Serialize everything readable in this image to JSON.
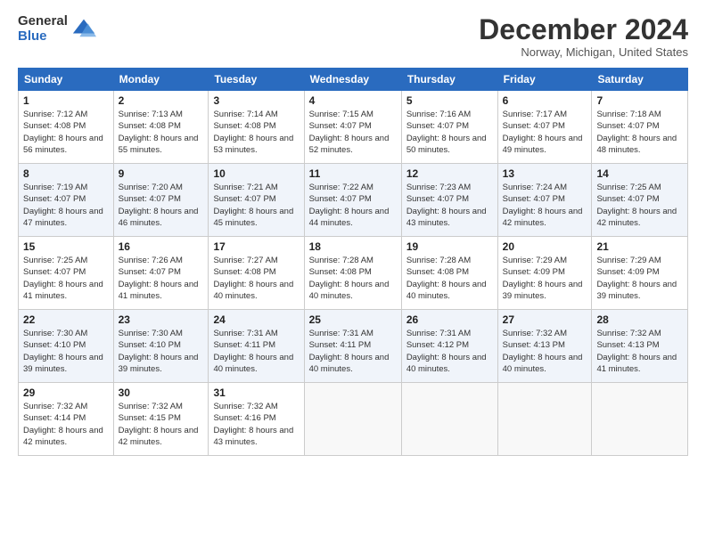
{
  "logo": {
    "general": "General",
    "blue": "Blue"
  },
  "title": "December 2024",
  "subtitle": "Norway, Michigan, United States",
  "days_of_week": [
    "Sunday",
    "Monday",
    "Tuesday",
    "Wednesday",
    "Thursday",
    "Friday",
    "Saturday"
  ],
  "weeks": [
    [
      {
        "day": "1",
        "sunrise": "7:12 AM",
        "sunset": "4:08 PM",
        "daylight": "8 hours and 56 minutes."
      },
      {
        "day": "2",
        "sunrise": "7:13 AM",
        "sunset": "4:08 PM",
        "daylight": "8 hours and 55 minutes."
      },
      {
        "day": "3",
        "sunrise": "7:14 AM",
        "sunset": "4:08 PM",
        "daylight": "8 hours and 53 minutes."
      },
      {
        "day": "4",
        "sunrise": "7:15 AM",
        "sunset": "4:07 PM",
        "daylight": "8 hours and 52 minutes."
      },
      {
        "day": "5",
        "sunrise": "7:16 AM",
        "sunset": "4:07 PM",
        "daylight": "8 hours and 50 minutes."
      },
      {
        "day": "6",
        "sunrise": "7:17 AM",
        "sunset": "4:07 PM",
        "daylight": "8 hours and 49 minutes."
      },
      {
        "day": "7",
        "sunrise": "7:18 AM",
        "sunset": "4:07 PM",
        "daylight": "8 hours and 48 minutes."
      }
    ],
    [
      {
        "day": "8",
        "sunrise": "7:19 AM",
        "sunset": "4:07 PM",
        "daylight": "8 hours and 47 minutes."
      },
      {
        "day": "9",
        "sunrise": "7:20 AM",
        "sunset": "4:07 PM",
        "daylight": "8 hours and 46 minutes."
      },
      {
        "day": "10",
        "sunrise": "7:21 AM",
        "sunset": "4:07 PM",
        "daylight": "8 hours and 45 minutes."
      },
      {
        "day": "11",
        "sunrise": "7:22 AM",
        "sunset": "4:07 PM",
        "daylight": "8 hours and 44 minutes."
      },
      {
        "day": "12",
        "sunrise": "7:23 AM",
        "sunset": "4:07 PM",
        "daylight": "8 hours and 43 minutes."
      },
      {
        "day": "13",
        "sunrise": "7:24 AM",
        "sunset": "4:07 PM",
        "daylight": "8 hours and 42 minutes."
      },
      {
        "day": "14",
        "sunrise": "7:25 AM",
        "sunset": "4:07 PM",
        "daylight": "8 hours and 42 minutes."
      }
    ],
    [
      {
        "day": "15",
        "sunrise": "7:25 AM",
        "sunset": "4:07 PM",
        "daylight": "8 hours and 41 minutes."
      },
      {
        "day": "16",
        "sunrise": "7:26 AM",
        "sunset": "4:07 PM",
        "daylight": "8 hours and 41 minutes."
      },
      {
        "day": "17",
        "sunrise": "7:27 AM",
        "sunset": "4:08 PM",
        "daylight": "8 hours and 40 minutes."
      },
      {
        "day": "18",
        "sunrise": "7:28 AM",
        "sunset": "4:08 PM",
        "daylight": "8 hours and 40 minutes."
      },
      {
        "day": "19",
        "sunrise": "7:28 AM",
        "sunset": "4:08 PM",
        "daylight": "8 hours and 40 minutes."
      },
      {
        "day": "20",
        "sunrise": "7:29 AM",
        "sunset": "4:09 PM",
        "daylight": "8 hours and 39 minutes."
      },
      {
        "day": "21",
        "sunrise": "7:29 AM",
        "sunset": "4:09 PM",
        "daylight": "8 hours and 39 minutes."
      }
    ],
    [
      {
        "day": "22",
        "sunrise": "7:30 AM",
        "sunset": "4:10 PM",
        "daylight": "8 hours and 39 minutes."
      },
      {
        "day": "23",
        "sunrise": "7:30 AM",
        "sunset": "4:10 PM",
        "daylight": "8 hours and 39 minutes."
      },
      {
        "day": "24",
        "sunrise": "7:31 AM",
        "sunset": "4:11 PM",
        "daylight": "8 hours and 40 minutes."
      },
      {
        "day": "25",
        "sunrise": "7:31 AM",
        "sunset": "4:11 PM",
        "daylight": "8 hours and 40 minutes."
      },
      {
        "day": "26",
        "sunrise": "7:31 AM",
        "sunset": "4:12 PM",
        "daylight": "8 hours and 40 minutes."
      },
      {
        "day": "27",
        "sunrise": "7:32 AM",
        "sunset": "4:13 PM",
        "daylight": "8 hours and 40 minutes."
      },
      {
        "day": "28",
        "sunrise": "7:32 AM",
        "sunset": "4:13 PM",
        "daylight": "8 hours and 41 minutes."
      }
    ],
    [
      {
        "day": "29",
        "sunrise": "7:32 AM",
        "sunset": "4:14 PM",
        "daylight": "8 hours and 42 minutes."
      },
      {
        "day": "30",
        "sunrise": "7:32 AM",
        "sunset": "4:15 PM",
        "daylight": "8 hours and 42 minutes."
      },
      {
        "day": "31",
        "sunrise": "7:32 AM",
        "sunset": "4:16 PM",
        "daylight": "8 hours and 43 minutes."
      },
      null,
      null,
      null,
      null
    ]
  ],
  "labels": {
    "sunrise": "Sunrise:",
    "sunset": "Sunset:",
    "daylight": "Daylight:"
  }
}
